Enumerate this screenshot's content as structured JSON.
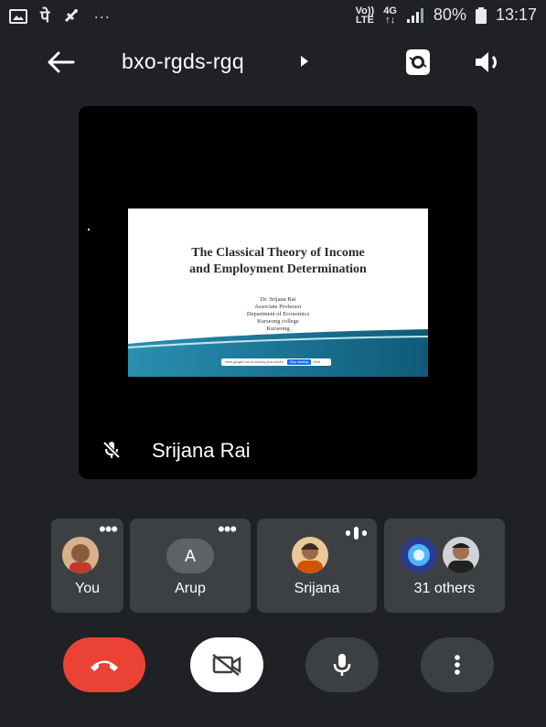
{
  "status_bar": {
    "left_icons": [
      "image-icon",
      "hindi-character-icon",
      "satellite-icon"
    ],
    "devanagari_char": "पे",
    "ellipsis": "···",
    "volte_line1": "Vo))",
    "volte_line2": "LTE",
    "net_line1": "4G",
    "net_line2": "↑↓",
    "battery": "80%",
    "time": "13:17"
  },
  "header": {
    "meeting_code": "bxo-rgds-rgq"
  },
  "main_video": {
    "presenter_name": "Srijana Rai",
    "mic_muted": true,
    "slide": {
      "title_line1": "The Classical Theory of Income",
      "title_line2": "and Employment Determination",
      "author": "Dr. Srijana Rai",
      "position": "Associate Professor",
      "department": "Department of Economics",
      "college": "Kurseong college",
      "place": "Kurseong",
      "share_bar_text": "meet.google.com is sharing your screen.",
      "share_stop": "Stop sharing",
      "share_hide": "Hide"
    }
  },
  "participants": [
    {
      "label": "You",
      "menu": "•••"
    },
    {
      "label": "Arup",
      "initial": "A",
      "menu": "•••"
    },
    {
      "label": "Srijana",
      "speaking": true
    },
    {
      "label": "31 others"
    }
  ],
  "colors": {
    "background": "#202124",
    "tile": "#3c4043",
    "end_call": "#ea4335",
    "arup_avatar": "#5f6368"
  }
}
